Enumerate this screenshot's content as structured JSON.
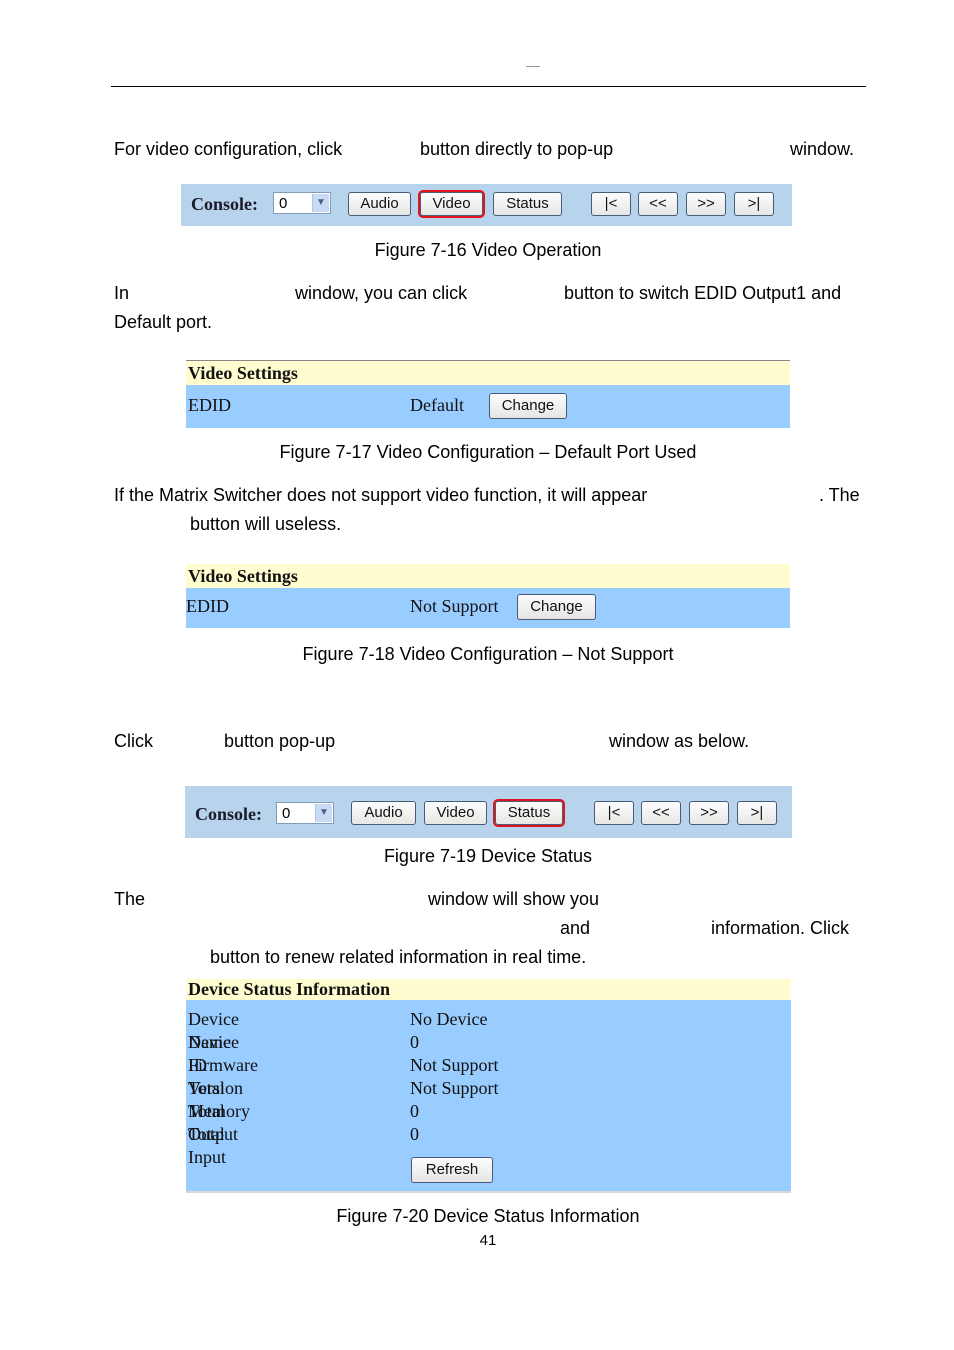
{
  "header": {
    "mark": "—"
  },
  "paragraphs": {
    "p1": {
      "a": "For video configuration, click",
      "b": "button directly to pop-up",
      "c": "window."
    },
    "p2": {
      "a": "In",
      "b": "window, you can click",
      "c": "button to switch EDID Output1 and",
      "d": "Default port."
    },
    "p3": {
      "a": "If the Matrix Switcher does not support video function, it will appear",
      "b": ". The",
      "c": "button will useless."
    },
    "p4": {
      "a": "Click",
      "b": "button pop-up",
      "c": "window as below."
    },
    "p5": {
      "a": "The",
      "b": "window  will  show  you",
      "c": "and",
      "d": "information.  Click",
      "e": "button to renew related information in real time."
    }
  },
  "figures": {
    "fig16": {
      "caption": "Figure 7-16 Video Operation",
      "console_label": "Console:",
      "console_value": "0",
      "buttons": [
        "Audio",
        "Video",
        "Status"
      ],
      "nav": [
        "|<",
        "<<",
        ">>",
        ">|"
      ],
      "highlighted": "Video"
    },
    "fig17": {
      "caption": "Figure 7-17 Video Configuration – Default Port Used",
      "title": "Video Settings",
      "field": "EDID",
      "value": "Default",
      "button": "Change"
    },
    "fig18": {
      "caption": "Figure 7-18 Video Configuration – Not Support",
      "title": "Video Settings",
      "field": "EDID",
      "value": "Not Support",
      "button": "Change"
    },
    "fig19": {
      "caption": "Figure 7-19 Device Status",
      "console_label": "Console:",
      "console_value": "0",
      "buttons": [
        "Audio",
        "Video",
        "Status"
      ],
      "nav": [
        "|<",
        "<<",
        ">>",
        ">|"
      ],
      "highlighted": "Status"
    },
    "fig20": {
      "caption": "Figure 7-20 Device Status Information",
      "title": "Device Status Information",
      "rows": [
        {
          "key": "Device Name",
          "value": "No Device"
        },
        {
          "key": "Device ID",
          "value": "0"
        },
        {
          "key": "Firmware Version",
          "value": "Not Support"
        },
        {
          "key": "Total Memory",
          "value": "Not Support"
        },
        {
          "key": "Total Output",
          "value": "0"
        },
        {
          "key": "Total Input",
          "value": "0"
        }
      ],
      "button": "Refresh"
    }
  },
  "colors": {
    "toolbar_bg": "#b8d3ec",
    "panel_header_bg": "#fffdd0",
    "panel_body_bg": "#99ccff",
    "highlight_border": "#e0141e"
  },
  "page_number": "41"
}
